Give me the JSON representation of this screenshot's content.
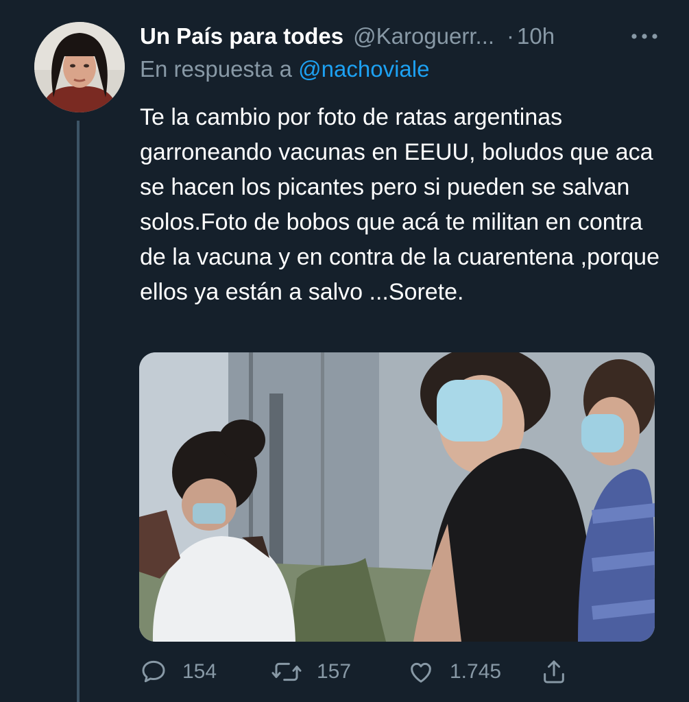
{
  "tweet": {
    "display_name": "Un País para todes",
    "handle": "@Karoguerr...",
    "time_separator": "·",
    "time": "10h",
    "reply_prefix": "En respuesta a",
    "reply_mention": "@nachoviale",
    "text": "Te la cambio por foto de ratas argentinas garroneando vacunas en EEUU, boludos que aca se hacen los picantes pero si pueden se salvan solos.Foto de bobos que acá te militan en contra de la vacuna y en contra de la cuarentena ,porque ellos ya están a salvo ...Sorete."
  },
  "actions": {
    "replies": "154",
    "retweets": "157",
    "likes": "1.745"
  },
  "icons": {
    "more": "more-horizontal-icon",
    "reply": "reply-bubble-icon",
    "retweet": "retweet-icon",
    "like": "heart-icon",
    "share": "share-upload-icon"
  },
  "colors": {
    "background": "#15202b",
    "text": "#ffffff",
    "secondary": "#8899a6",
    "link": "#1da1f2",
    "thread_line": "#3d5466"
  }
}
